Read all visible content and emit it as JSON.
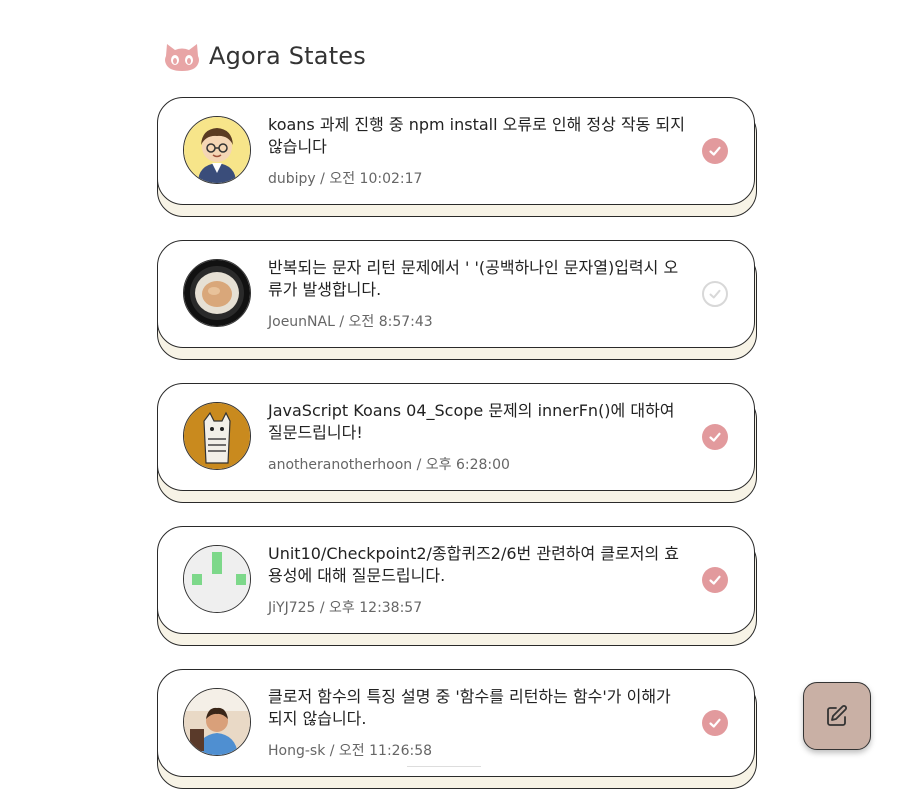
{
  "app": {
    "title": "Agora States",
    "logo_icon": "octocat-icon"
  },
  "colors": {
    "answered": "#e29a9d",
    "unanswered_border": "#d8d8d8",
    "fab": "#c9b0a5",
    "card_shadow": "#f7f3e6"
  },
  "discussions": [
    {
      "title": "koans 과제 진행 중 npm install 오류로 인해 정상 작동 되지 않습니다",
      "meta": "dubipy / 오전 10:02:17",
      "answered": true,
      "avatar": "cartoon-boy-avatar"
    },
    {
      "title": "반복되는 문자 리턴 문제에서 ' '(공백하나인 문자열)입력시 오류가 발생합니다.",
      "meta": "JoeunNAL / 오전 8:57:43",
      "answered": false,
      "avatar": "bowl-photo-avatar"
    },
    {
      "title": "JavaScript Koans 04_Scope 문제의 innerFn()에 대하여 질문드립니다!",
      "meta": "anotheranotherhoon / 오후 6:28:00",
      "answered": true,
      "avatar": "cat-drawing-avatar"
    },
    {
      "title": "Unit10/Checkpoint2/종합퀴즈2/6번 관련하여 클로저의 효용성에 대해 질문드립니다.",
      "meta": "JiYJ725 / 오후 12:38:57",
      "answered": true,
      "avatar": "identicon-avatar"
    },
    {
      "title": "클로저 함수의 특징 설명 중 '함수를 리턴하는 함수'가 이해가 되지 않습니다.",
      "meta": "Hong-sk / 오전 11:26:58",
      "answered": true,
      "avatar": "person-photo-avatar"
    }
  ],
  "fab": {
    "icon": "edit-icon"
  }
}
